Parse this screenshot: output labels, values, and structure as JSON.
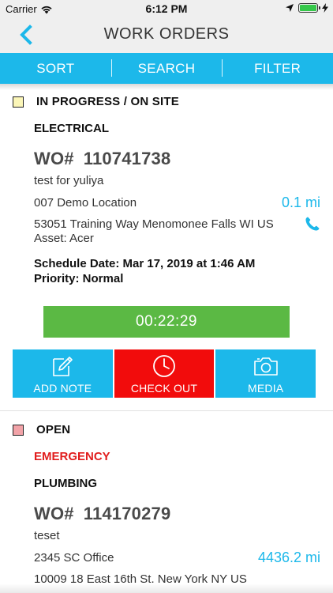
{
  "status_bar": {
    "carrier": "Carrier",
    "time": "6:12 PM",
    "battery_level": 1.0,
    "battery_color": "#35c84a"
  },
  "nav": {
    "back_icon": "chevron-left-icon",
    "title": "WORK ORDERS"
  },
  "toolbar": {
    "sort_label": "SORT",
    "search_label": "SEARCH",
    "filter_label": "FILTER",
    "color": "#1cb8ea"
  },
  "orders": [
    {
      "status": "IN PROGRESS / ON SITE",
      "status_color": "#fbf6b8",
      "category": "ELECTRICAL",
      "wo_prefix": "WO#",
      "wo_number": "110741738",
      "description": "test for yuliya",
      "location": "007 Demo Location",
      "distance": "0.1 mi",
      "address": "53051 Training Way Menomonee Falls WI US",
      "asset": "Asset: Acer",
      "schedule": "Schedule Date: Mar 17, 2019 at 1:46 AM",
      "priority": "Priority:  Normal",
      "timer": "00:22:29",
      "actions": {
        "add_note": "ADD NOTE",
        "check_out": "CHECK OUT",
        "media": "MEDIA"
      }
    },
    {
      "status": "OPEN",
      "status_color": "#f2a3a8",
      "flag": "EMERGENCY",
      "category": "PLUMBING",
      "wo_prefix": "WO#",
      "wo_number": "114170279",
      "description": "teset",
      "location": "2345 SC Office",
      "distance": "4436.2 mi",
      "address": "10009 18 East 16th St. New York NY US"
    }
  ]
}
